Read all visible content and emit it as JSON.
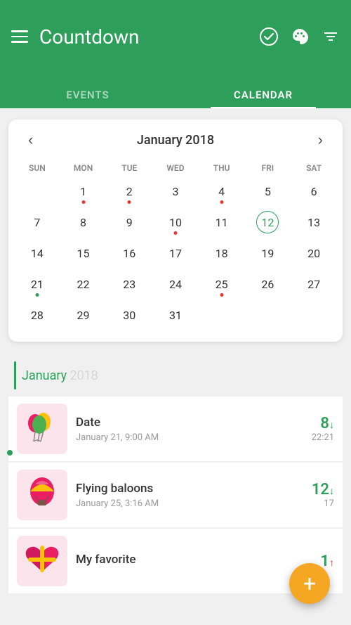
{
  "header": {
    "title": "Countdown",
    "icons": {
      "menu": "☰",
      "check": "✔",
      "palette": "🎨",
      "sort": "⇅"
    }
  },
  "tabs": [
    {
      "id": "events",
      "label": "EVENTS",
      "active": false
    },
    {
      "id": "calendar",
      "label": "CALENDAR",
      "active": true
    }
  ],
  "calendar": {
    "month_title": "January 2018",
    "nav_prev": "‹",
    "nav_next": "›",
    "weekdays": [
      "SUN",
      "MON",
      "TUE",
      "WED",
      "THU",
      "FRI",
      "SAT"
    ],
    "weeks": [
      [
        null,
        1,
        2,
        3,
        4,
        5,
        6
      ],
      [
        7,
        8,
        9,
        10,
        11,
        12,
        13
      ],
      [
        14,
        15,
        16,
        17,
        18,
        19,
        20
      ],
      [
        21,
        22,
        23,
        24,
        25,
        26,
        27
      ],
      [
        28,
        29,
        30,
        31,
        null,
        null,
        null
      ]
    ],
    "today": 12,
    "dots_red": [
      1,
      2,
      4,
      10,
      25
    ],
    "dots_green": [
      21
    ]
  },
  "events_section": {
    "month": "January",
    "year": "2018"
  },
  "events": [
    {
      "id": "date-event",
      "name": "Date",
      "date": "January 21, 9:00 AM",
      "days": "8",
      "time": "22:21",
      "direction": "↓",
      "thumbnail_emoji": "🎈",
      "thumbnail_class": "thumb-balloons"
    },
    {
      "id": "flying-balloons",
      "name": "Flying baloons",
      "date": "January 25, 3:16 AM",
      "days": "12",
      "time": "17",
      "direction": "↓",
      "thumbnail_emoji": "🎈",
      "thumbnail_class": "thumb-balloon-ride"
    },
    {
      "id": "my-favorite",
      "name": "My favorite",
      "date": "",
      "days": "1",
      "time": "",
      "direction": "↑",
      "thumbnail_emoji": "💝",
      "thumbnail_class": "thumb-heart"
    }
  ],
  "fab": {
    "label": "+"
  }
}
